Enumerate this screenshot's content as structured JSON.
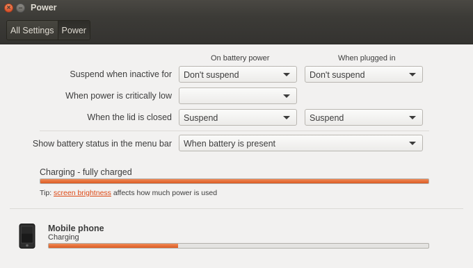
{
  "window": {
    "title": "Power",
    "close_glyph": "×",
    "minimize_glyph": "–"
  },
  "toolbar": {
    "crumbs": [
      "All Settings",
      "Power"
    ]
  },
  "columns": {
    "battery": "On battery power",
    "plugged": "When plugged in"
  },
  "rows": {
    "suspend": {
      "label": "Suspend when inactive for",
      "battery_value": "Don't suspend",
      "plugged_value": "Don't suspend"
    },
    "critical": {
      "label": "When power is critically low",
      "battery_value": ""
    },
    "lid": {
      "label": "When the lid is closed",
      "battery_value": "Suspend",
      "plugged_value": "Suspend"
    },
    "battery_status": {
      "label": "Show battery status in the menu bar",
      "value": "When battery is present"
    }
  },
  "battery": {
    "status": "Charging - fully charged",
    "level_fraction": 1.0,
    "tip_prefix": "Tip: ",
    "tip_link": "screen brightness",
    "tip_suffix": " affects how much power is used"
  },
  "device": {
    "icon": "phone-icon",
    "name": "Mobile phone",
    "status": "Charging",
    "level_fraction": 0.34
  },
  "colors": {
    "accent": "#dd4814",
    "titlebar": "#3c3b37",
    "background": "#f2f1f0"
  }
}
